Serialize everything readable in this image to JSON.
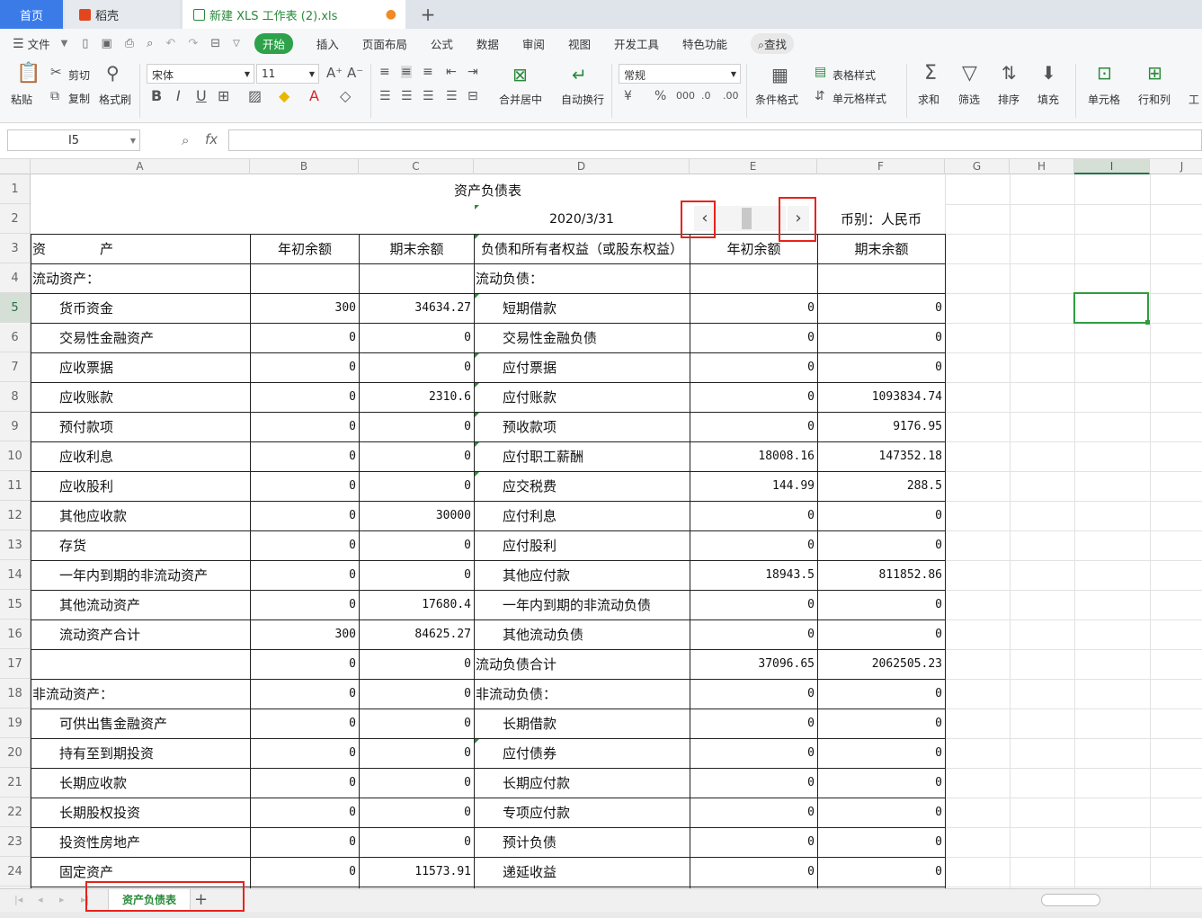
{
  "tabs": {
    "home": "首页",
    "dk": "稻壳",
    "file": "新建 XLS 工作表 (2).xls",
    "add": "+"
  },
  "menu": [
    "文件",
    "开始",
    "插入",
    "页面布局",
    "公式",
    "数据",
    "审阅",
    "视图",
    "开发工具",
    "特色功能",
    "查找"
  ],
  "ribbon": {
    "paste": "粘贴",
    "cut": "剪切",
    "copy": "复制",
    "format_painter": "格式刷",
    "font": "宋体",
    "font_size": "11",
    "bold": "B",
    "italic": "I",
    "underline": "U",
    "merge": "合并居中",
    "wrap": "自动换行",
    "number_format": "常规",
    "cond_format": "条件格式",
    "table_style": "表格样式",
    "cell_style": "单元格样式",
    "sum": "求和",
    "filter": "筛选",
    "sort": "排序",
    "fill": "填充",
    "cell": "单元格",
    "rowcol": "行和列",
    "ws": "工"
  },
  "formula": {
    "name_box": "I5",
    "fx": "fx",
    "value": ""
  },
  "columns": [
    "A",
    "B",
    "C",
    "D",
    "E",
    "F",
    "G",
    "H",
    "I",
    "J"
  ],
  "rows": [
    "1",
    "2",
    "3",
    "4",
    "5",
    "6",
    "7",
    "8",
    "9",
    "10",
    "11",
    "12",
    "13",
    "14",
    "15",
    "16",
    "17",
    "18",
    "19",
    "20",
    "21",
    "22",
    "23",
    "24"
  ],
  "sheet": {
    "title": "资产负债表",
    "date": "2020/3/31",
    "currency": "币别：人民币",
    "header": [
      "资　　　　产",
      "年初余额",
      "期末余额",
      "负债和所有者权益（或股东权益）",
      "年初余额",
      "期末余额"
    ],
    "body": [
      [
        "流动资产：",
        "",
        "",
        "流动负债：",
        "",
        ""
      ],
      [
        "　　货币资金",
        "300",
        "34634.27",
        "　　短期借款",
        "0",
        "0"
      ],
      [
        "　　交易性金融资产",
        "0",
        "0",
        "　　交易性金融负债",
        "0",
        "0"
      ],
      [
        "　　应收票据",
        "0",
        "0",
        "　　应付票据",
        "0",
        "0"
      ],
      [
        "　　应收账款",
        "0",
        "2310.6",
        "　　应付账款",
        "0",
        "1093834.74"
      ],
      [
        "　　预付款项",
        "0",
        "0",
        "　　预收款项",
        "0",
        "9176.95"
      ],
      [
        "　　应收利息",
        "0",
        "0",
        "　　应付职工薪酬",
        "18008.16",
        "147352.18"
      ],
      [
        "　　应收股利",
        "0",
        "0",
        "　　应交税费",
        "144.99",
        "288.5"
      ],
      [
        "　　其他应收款",
        "0",
        "30000",
        "　　应付利息",
        "0",
        "0"
      ],
      [
        "　　存货",
        "0",
        "0",
        "　　应付股利",
        "0",
        "0"
      ],
      [
        "　　一年内到期的非流动资产",
        "0",
        "0",
        "　　其他应付款",
        "18943.5",
        "811852.86"
      ],
      [
        "　　其他流动资产",
        "0",
        "17680.4",
        "　　一年内到期的非流动负债",
        "0",
        "0"
      ],
      [
        "　　流动资产合计",
        "300",
        "84625.27",
        "　　其他流动负债",
        "0",
        "0"
      ],
      [
        "",
        "0",
        "0",
        "流动负债合计",
        "37096.65",
        "2062505.23"
      ],
      [
        "非流动资产：",
        "0",
        "0",
        "非流动负债：",
        "0",
        "0"
      ],
      [
        "　　可供出售金融资产",
        "0",
        "0",
        "　　长期借款",
        "0",
        "0"
      ],
      [
        "　　持有至到期投资",
        "0",
        "0",
        "　　应付债券",
        "0",
        "0"
      ],
      [
        "　　长期应收款",
        "0",
        "0",
        "　　长期应付款",
        "0",
        "0"
      ],
      [
        "　　长期股权投资",
        "0",
        "0",
        "　　专项应付款",
        "0",
        "0"
      ],
      [
        "　　投资性房地产",
        "0",
        "0",
        "　　预计负债",
        "0",
        "0"
      ],
      [
        "　　固定资产",
        "0",
        "11573.91",
        "　　递延收益",
        "0",
        "0"
      ]
    ]
  },
  "nav": {
    "prev": "‹",
    "next": "›"
  },
  "sheet_tab": "资产负债表",
  "sheet_add": "+",
  "colors": {
    "accent": "#2ea24a",
    "highlight": "#e8221b",
    "selection": "#2e9d3f"
  }
}
